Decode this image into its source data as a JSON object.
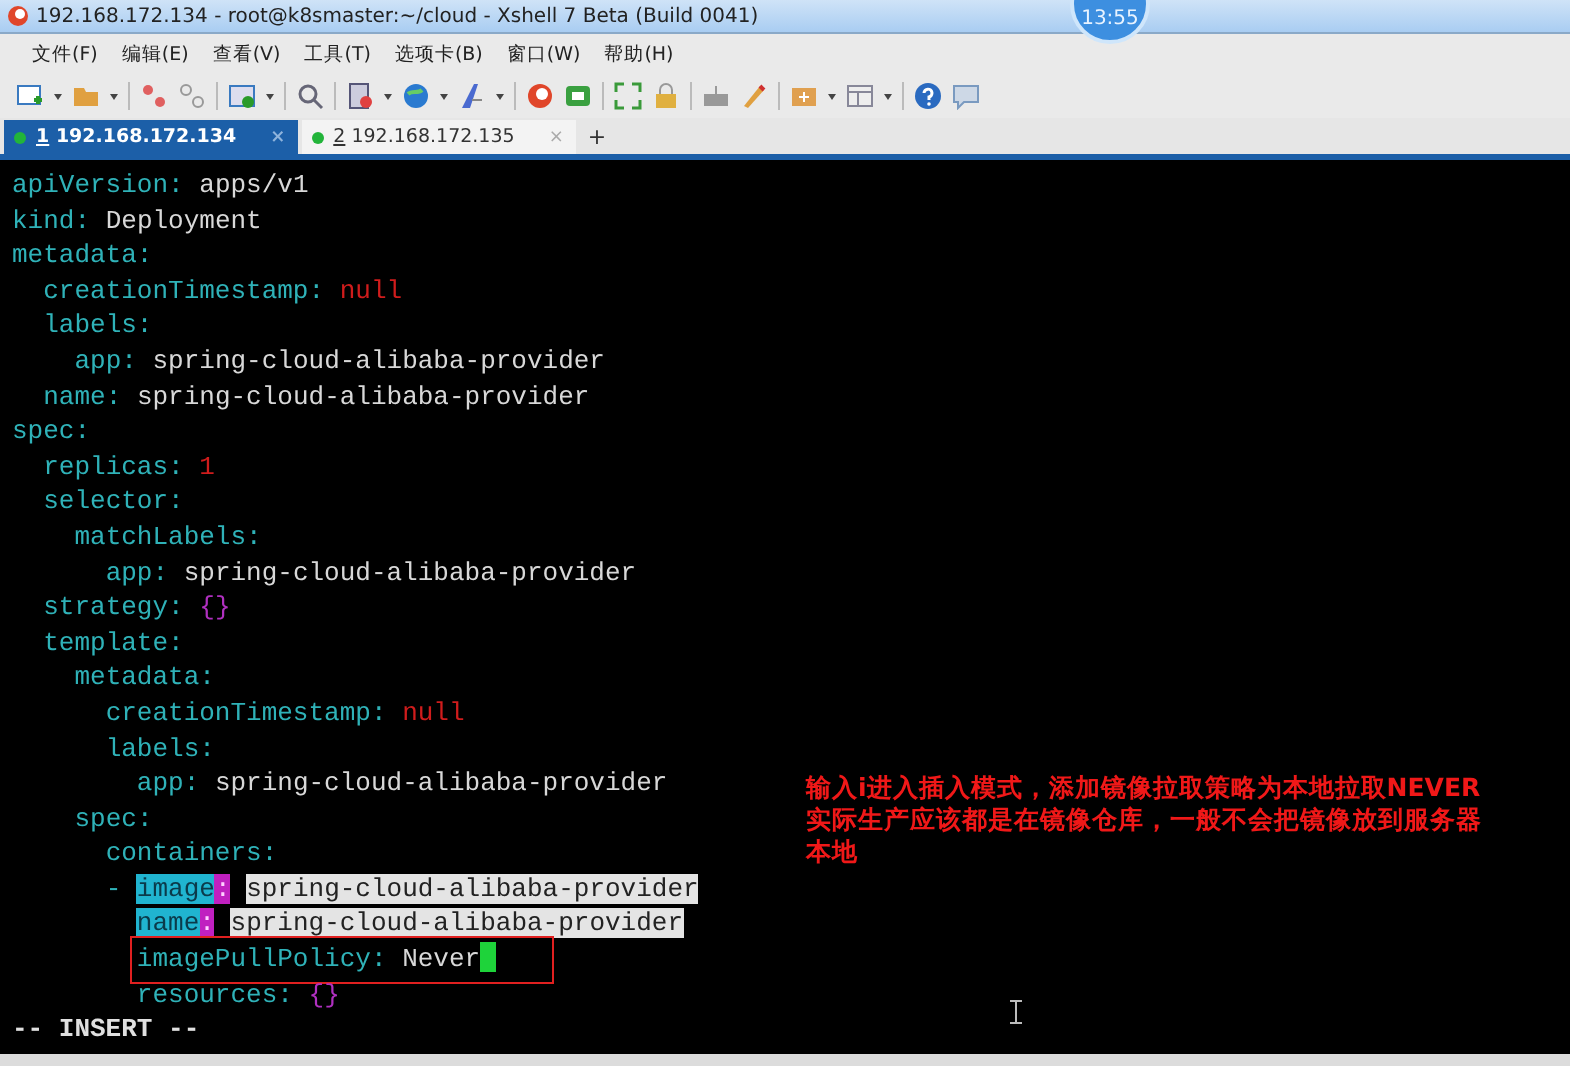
{
  "window": {
    "title": "192.168.172.134 - root@k8smaster:~/cloud - Xshell 7 Beta (Build 0041)"
  },
  "clock_badge": "13:55",
  "menu": [
    "文件(F)",
    "编辑(E)",
    "查看(V)",
    "工具(T)",
    "选项卡(B)",
    "窗口(W)",
    "帮助(H)"
  ],
  "tabs": [
    {
      "number": "1",
      "label": "192.168.172.134",
      "selected": true,
      "close": "×"
    },
    {
      "number": "2",
      "label": "192.168.172.135",
      "selected": false,
      "close": "×"
    }
  ],
  "new_tab": "+",
  "terminal": {
    "yaml": [
      {
        "key": "apiVersion",
        "colon": ":",
        "value": "apps/v1",
        "kind": "string"
      },
      {
        "key": "kind",
        "colon": ":",
        "value": "Deployment",
        "kind": "string"
      },
      {
        "key": "metadata",
        "colon": ":",
        "children": [
          {
            "key": "creationTimestamp",
            "colon": ":",
            "value": "null",
            "kind": "null"
          },
          {
            "key": "labels",
            "colon": ":",
            "children": [
              {
                "key": "app",
                "colon": ":",
                "value": "spring-cloud-alibaba-provider",
                "kind": "string"
              }
            ]
          },
          {
            "key": "name",
            "colon": ":",
            "value": "spring-cloud-alibaba-provider",
            "kind": "string"
          }
        ]
      },
      {
        "key": "spec",
        "colon": ":",
        "children": [
          {
            "key": "replicas",
            "colon": ":",
            "value": "1",
            "kind": "number"
          },
          {
            "key": "selector",
            "colon": ":",
            "children": [
              {
                "key": "matchLabels",
                "colon": ":",
                "children": [
                  {
                    "key": "app",
                    "colon": ":",
                    "value": "spring-cloud-alibaba-provider",
                    "kind": "string"
                  }
                ]
              }
            ]
          },
          {
            "key": "strategy",
            "colon": ":",
            "value": "{}",
            "kind": "braces"
          },
          {
            "key": "template",
            "colon": ":",
            "children": [
              {
                "key": "metadata",
                "colon": ":",
                "children": [
                  {
                    "key": "creationTimestamp",
                    "colon": ":",
                    "value": "null",
                    "kind": "null"
                  },
                  {
                    "key": "labels",
                    "colon": ":",
                    "children": [
                      {
                        "key": "app",
                        "colon": ":",
                        "value": "spring-cloud-alibaba-provider",
                        "kind": "string"
                      }
                    ]
                  }
                ]
              },
              {
                "key": "spec",
                "colon": ":",
                "children": [
                  {
                    "key": "containers",
                    "colon": ":",
                    "children": [
                      {
                        "dash": "-",
                        "key": "image",
                        "colon": ":",
                        "value": "spring-cloud-alibaba-provider",
                        "kind": "string",
                        "selected": true
                      },
                      {
                        "key": "name",
                        "colon": ":",
                        "value": "spring-cloud-alibaba-provider",
                        "kind": "string",
                        "selected": true
                      },
                      {
                        "key": "imagePullPolicy",
                        "colon": ":",
                        "value": "Never",
                        "kind": "string",
                        "boxed": true,
                        "cursor": true
                      },
                      {
                        "key": "resources",
                        "colon": ":",
                        "value": "{}",
                        "kind": "braces"
                      }
                    ]
                  }
                ]
              }
            ]
          }
        ]
      }
    ],
    "mode": "-- INSERT --"
  },
  "annotation": [
    "输入i进入插入模式，添加镜像拉取策略为本地拉取NEVER",
    "实际生产应该都是在镜像仓库，一般不会把镜像放到服务器",
    "本地"
  ]
}
